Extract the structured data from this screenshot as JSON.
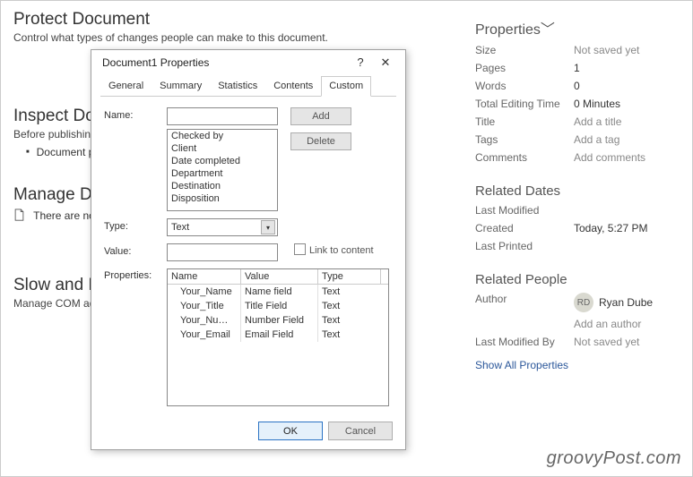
{
  "bg": {
    "protect": {
      "title": "Protect Document",
      "sub": "Control what types of changes people can make to this document."
    },
    "inspect": {
      "title": "Inspect Do",
      "sub": "Before publishin",
      "bullet": "Document p"
    },
    "manage": {
      "title": "Manage D",
      "sub": "There are no"
    },
    "slow": {
      "title": "Slow and D",
      "sub": "Manage COM ad"
    }
  },
  "right": {
    "properties_label": "Properties",
    "fields": {
      "size_k": "Size",
      "size_v": "Not saved yet",
      "pages_k": "Pages",
      "pages_v": "1",
      "words_k": "Words",
      "words_v": "0",
      "tet_k": "Total Editing Time",
      "tet_v": "0 Minutes",
      "title_k": "Title",
      "title_v": "Add a title",
      "tags_k": "Tags",
      "tags_v": "Add a tag",
      "comments_k": "Comments",
      "comments_v": "Add comments"
    },
    "dates": {
      "head": "Related Dates",
      "lm_k": "Last Modified",
      "lm_v": "",
      "cr_k": "Created",
      "cr_v": "Today, 5:27 PM",
      "lp_k": "Last Printed",
      "lp_v": ""
    },
    "people": {
      "head": "Related People",
      "author_k": "Author",
      "author_initials": "RD",
      "author_name": "Ryan Dube",
      "add_author": "Add an author",
      "lmb_k": "Last Modified By",
      "lmb_v": "Not saved yet",
      "show_all": "Show All Properties"
    }
  },
  "dialog": {
    "title": "Document1 Properties",
    "help": "?",
    "close": "✕",
    "tabs": [
      "General",
      "Summary",
      "Statistics",
      "Contents",
      "Custom"
    ],
    "active_tab": "Custom",
    "labels": {
      "name": "Name:",
      "type": "Type:",
      "value": "Value:",
      "props": "Properties:"
    },
    "name_value": "",
    "suggestions": [
      "Checked by",
      "Client",
      "Date completed",
      "Department",
      "Destination",
      "Disposition"
    ],
    "add": "Add",
    "delete": "Delete",
    "type_value": "Text",
    "value_value": "",
    "link_to_content": "Link to content",
    "table": {
      "headers": [
        "Name",
        "Value",
        "Type"
      ],
      "rows": [
        {
          "n": "Your_Name",
          "v": "Name field",
          "t": "Text"
        },
        {
          "n": "Your_Title",
          "v": "Title Field",
          "t": "Text"
        },
        {
          "n": "Your_Nu…",
          "v": "Number Field",
          "t": "Text"
        },
        {
          "n": "Your_Email",
          "v": "Email Field",
          "t": "Text"
        }
      ]
    },
    "ok": "OK",
    "cancel": "Cancel"
  },
  "watermark": "groovyPost.com"
}
